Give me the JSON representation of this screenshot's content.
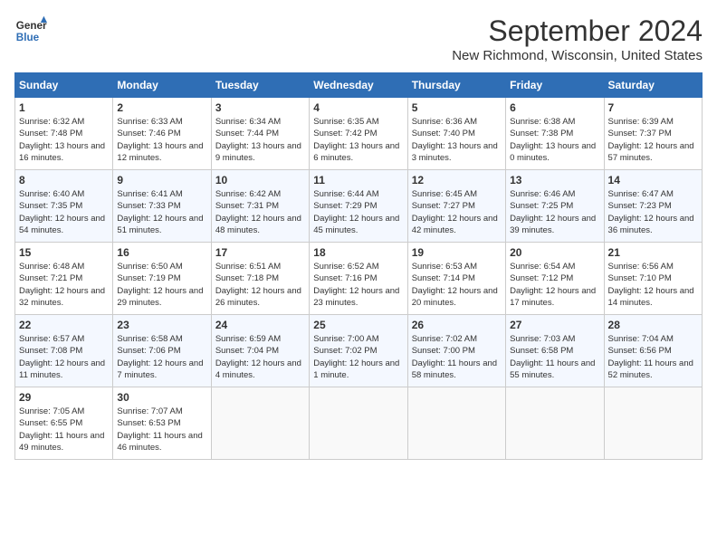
{
  "header": {
    "logo_line1": "General",
    "logo_line2": "Blue",
    "month": "September 2024",
    "location": "New Richmond, Wisconsin, United States"
  },
  "weekdays": [
    "Sunday",
    "Monday",
    "Tuesday",
    "Wednesday",
    "Thursday",
    "Friday",
    "Saturday"
  ],
  "weeks": [
    [
      {
        "day": "1",
        "sunrise": "Sunrise: 6:32 AM",
        "sunset": "Sunset: 7:48 PM",
        "daylight": "Daylight: 13 hours and 16 minutes."
      },
      {
        "day": "2",
        "sunrise": "Sunrise: 6:33 AM",
        "sunset": "Sunset: 7:46 PM",
        "daylight": "Daylight: 13 hours and 12 minutes."
      },
      {
        "day": "3",
        "sunrise": "Sunrise: 6:34 AM",
        "sunset": "Sunset: 7:44 PM",
        "daylight": "Daylight: 13 hours and 9 minutes."
      },
      {
        "day": "4",
        "sunrise": "Sunrise: 6:35 AM",
        "sunset": "Sunset: 7:42 PM",
        "daylight": "Daylight: 13 hours and 6 minutes."
      },
      {
        "day": "5",
        "sunrise": "Sunrise: 6:36 AM",
        "sunset": "Sunset: 7:40 PM",
        "daylight": "Daylight: 13 hours and 3 minutes."
      },
      {
        "day": "6",
        "sunrise": "Sunrise: 6:38 AM",
        "sunset": "Sunset: 7:38 PM",
        "daylight": "Daylight: 13 hours and 0 minutes."
      },
      {
        "day": "7",
        "sunrise": "Sunrise: 6:39 AM",
        "sunset": "Sunset: 7:37 PM",
        "daylight": "Daylight: 12 hours and 57 minutes."
      }
    ],
    [
      {
        "day": "8",
        "sunrise": "Sunrise: 6:40 AM",
        "sunset": "Sunset: 7:35 PM",
        "daylight": "Daylight: 12 hours and 54 minutes."
      },
      {
        "day": "9",
        "sunrise": "Sunrise: 6:41 AM",
        "sunset": "Sunset: 7:33 PM",
        "daylight": "Daylight: 12 hours and 51 minutes."
      },
      {
        "day": "10",
        "sunrise": "Sunrise: 6:42 AM",
        "sunset": "Sunset: 7:31 PM",
        "daylight": "Daylight: 12 hours and 48 minutes."
      },
      {
        "day": "11",
        "sunrise": "Sunrise: 6:44 AM",
        "sunset": "Sunset: 7:29 PM",
        "daylight": "Daylight: 12 hours and 45 minutes."
      },
      {
        "day": "12",
        "sunrise": "Sunrise: 6:45 AM",
        "sunset": "Sunset: 7:27 PM",
        "daylight": "Daylight: 12 hours and 42 minutes."
      },
      {
        "day": "13",
        "sunrise": "Sunrise: 6:46 AM",
        "sunset": "Sunset: 7:25 PM",
        "daylight": "Daylight: 12 hours and 39 minutes."
      },
      {
        "day": "14",
        "sunrise": "Sunrise: 6:47 AM",
        "sunset": "Sunset: 7:23 PM",
        "daylight": "Daylight: 12 hours and 36 minutes."
      }
    ],
    [
      {
        "day": "15",
        "sunrise": "Sunrise: 6:48 AM",
        "sunset": "Sunset: 7:21 PM",
        "daylight": "Daylight: 12 hours and 32 minutes."
      },
      {
        "day": "16",
        "sunrise": "Sunrise: 6:50 AM",
        "sunset": "Sunset: 7:19 PM",
        "daylight": "Daylight: 12 hours and 29 minutes."
      },
      {
        "day": "17",
        "sunrise": "Sunrise: 6:51 AM",
        "sunset": "Sunset: 7:18 PM",
        "daylight": "Daylight: 12 hours and 26 minutes."
      },
      {
        "day": "18",
        "sunrise": "Sunrise: 6:52 AM",
        "sunset": "Sunset: 7:16 PM",
        "daylight": "Daylight: 12 hours and 23 minutes."
      },
      {
        "day": "19",
        "sunrise": "Sunrise: 6:53 AM",
        "sunset": "Sunset: 7:14 PM",
        "daylight": "Daylight: 12 hours and 20 minutes."
      },
      {
        "day": "20",
        "sunrise": "Sunrise: 6:54 AM",
        "sunset": "Sunset: 7:12 PM",
        "daylight": "Daylight: 12 hours and 17 minutes."
      },
      {
        "day": "21",
        "sunrise": "Sunrise: 6:56 AM",
        "sunset": "Sunset: 7:10 PM",
        "daylight": "Daylight: 12 hours and 14 minutes."
      }
    ],
    [
      {
        "day": "22",
        "sunrise": "Sunrise: 6:57 AM",
        "sunset": "Sunset: 7:08 PM",
        "daylight": "Daylight: 12 hours and 11 minutes."
      },
      {
        "day": "23",
        "sunrise": "Sunrise: 6:58 AM",
        "sunset": "Sunset: 7:06 PM",
        "daylight": "Daylight: 12 hours and 7 minutes."
      },
      {
        "day": "24",
        "sunrise": "Sunrise: 6:59 AM",
        "sunset": "Sunset: 7:04 PM",
        "daylight": "Daylight: 12 hours and 4 minutes."
      },
      {
        "day": "25",
        "sunrise": "Sunrise: 7:00 AM",
        "sunset": "Sunset: 7:02 PM",
        "daylight": "Daylight: 12 hours and 1 minute."
      },
      {
        "day": "26",
        "sunrise": "Sunrise: 7:02 AM",
        "sunset": "Sunset: 7:00 PM",
        "daylight": "Daylight: 11 hours and 58 minutes."
      },
      {
        "day": "27",
        "sunrise": "Sunrise: 7:03 AM",
        "sunset": "Sunset: 6:58 PM",
        "daylight": "Daylight: 11 hours and 55 minutes."
      },
      {
        "day": "28",
        "sunrise": "Sunrise: 7:04 AM",
        "sunset": "Sunset: 6:56 PM",
        "daylight": "Daylight: 11 hours and 52 minutes."
      }
    ],
    [
      {
        "day": "29",
        "sunrise": "Sunrise: 7:05 AM",
        "sunset": "Sunset: 6:55 PM",
        "daylight": "Daylight: 11 hours and 49 minutes."
      },
      {
        "day": "30",
        "sunrise": "Sunrise: 7:07 AM",
        "sunset": "Sunset: 6:53 PM",
        "daylight": "Daylight: 11 hours and 46 minutes."
      },
      null,
      null,
      null,
      null,
      null
    ]
  ]
}
